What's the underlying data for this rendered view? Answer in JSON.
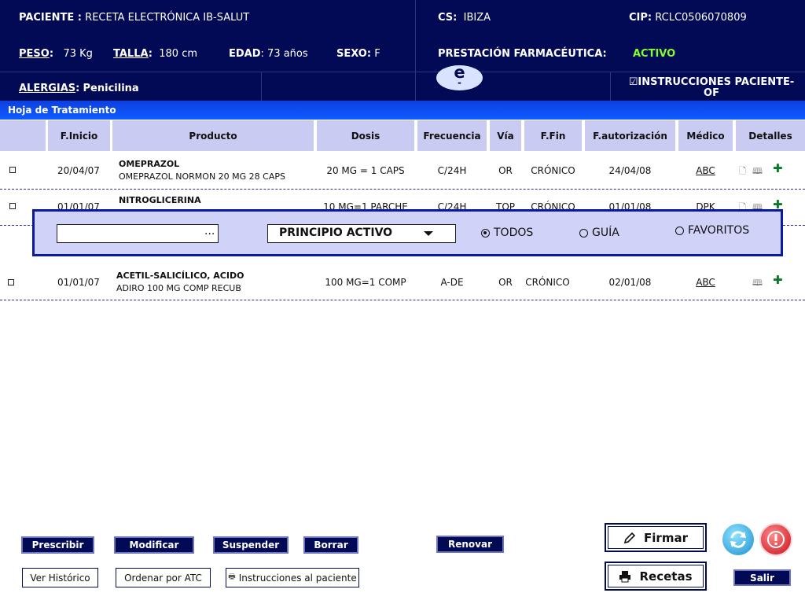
{
  "header": {
    "paciente_label": "PACIENTE :",
    "paciente_value": "RECETA ELECTRÓNICA IB-SALUT",
    "cs_label": "CS:",
    "cs_value": "IBIZA",
    "cip_label": "CIP:",
    "cip_value": "RCLC0506070809",
    "peso_label": "PESO",
    "peso_value": "73 Kg",
    "talla_label": "TALLA",
    "talla_value": "180 cm",
    "edad_label": "EDAD",
    "edad_value": ": 73 años",
    "sexo_label": "SEXO:",
    "sexo_value": "F",
    "prestacion_label": "PRESTACIÓN FARMACÉUTICA:",
    "prestacion_value": "ACTIVO",
    "alergias_label": "ALERGIAS",
    "alergias_value": "Penicilina",
    "logo_letter": "e",
    "logo_dash": "-",
    "instrucciones_line1": "☑INSTRUCCIONES PACIENTE-",
    "instrucciones_line2": "OF"
  },
  "section_title": "Hoja de Tratamiento",
  "table": {
    "columns": [
      "F.Inicio",
      "Producto",
      "Dosis",
      "Frecuencia",
      "Vía",
      "F.Fin",
      "F.autorización",
      "Médico",
      "Detalles"
    ],
    "rows": [
      {
        "inicio": "20/04/07",
        "principio": "OMEPRAZOL",
        "marca": "OMEPRAZOL NORMON 20 MG 28 CAPS",
        "dosis": "20 MG = 1 CAPS",
        "frecuencia": "C/24H",
        "via": "OR",
        "fin": "CRÓNICO",
        "autorizacion": "24/04/08",
        "medico": "ABC"
      },
      {
        "inicio": "01/01/07",
        "principio": "NITROGLICERINA",
        "marca": "",
        "dosis": "10 MG=1 PARCHE",
        "frecuencia": "C/24H",
        "via": "TOP",
        "fin": "CRÓNICO",
        "autorizacion": "01/01/08",
        "medico": "DPK"
      },
      {
        "inicio": "01/01/07",
        "principio": "ACETIL-SALICÍLICO, ACIDO",
        "marca": "ADIRO 100 MG COMP RECUB",
        "dosis": "100 MG=1 COMP",
        "frecuencia": "A-DE",
        "via": "OR",
        "fin": "CRÓNICO",
        "autorizacion": "02/01/08",
        "medico": "ABC"
      }
    ]
  },
  "search": {
    "input_value": "",
    "dots": "...",
    "select_value": "PRINCIPIO ACTIVO",
    "radio_todos": "TODOS",
    "radio_guia": "GUÍA",
    "radio_favoritos": "FAVORITOS"
  },
  "buttons": {
    "prescribir": "Prescribir",
    "modificar": "Modificar",
    "suspender": "Suspender",
    "borrar": "Borrar",
    "renovar": "Renovar",
    "firmar": "Firmar",
    "ver_historico": "Ver Histórico",
    "ordenar_atc": "Ordenar por ATC",
    "instrucciones": "Instrucciones al paciente",
    "recetas": "Recetas",
    "salir": "Salir"
  },
  "icons": {
    "firmar": "pencil-icon",
    "recetas": "printer-icon",
    "instrucciones": "printer-icon",
    "refresh": "refresh-icon",
    "alert": "alert-icon"
  },
  "colors": {
    "header_bg": "#030a55",
    "accent_blue": "#0f5cff",
    "active_green": "#7fff30",
    "table_header": "#c9cbf2"
  }
}
